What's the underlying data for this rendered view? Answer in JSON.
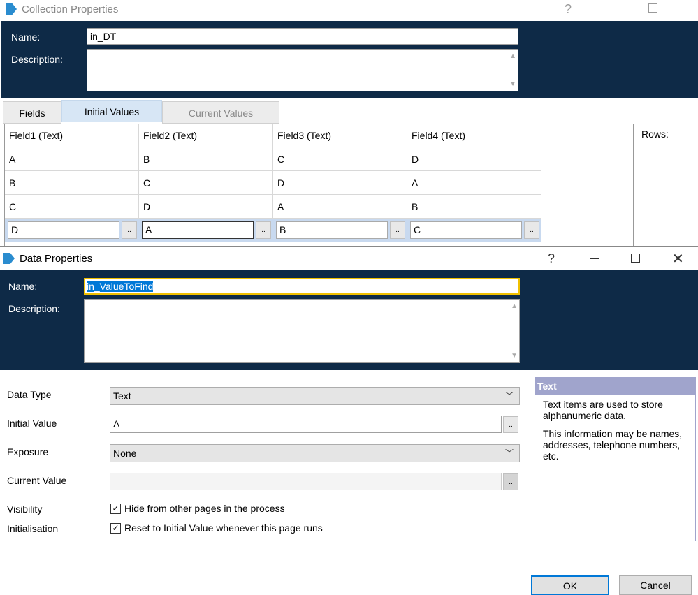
{
  "collection": {
    "title": "Collection Properties",
    "help": "?",
    "name_label": "Name:",
    "name_value": "in_DT",
    "description_label": "Description:",
    "tabs": [
      "Fields",
      "Initial Values",
      "Current Values"
    ],
    "rows_label": "Rows:",
    "columns": [
      "Field1  (Text)",
      "Field2  (Text)",
      "Field3  (Text)",
      "Field4  (Text)"
    ],
    "rows": [
      [
        "A",
        "B",
        "C",
        "D"
      ],
      [
        "B",
        "C",
        "D",
        "A"
      ],
      [
        "C",
        "D",
        "A",
        "B"
      ]
    ],
    "edit_row": [
      "D",
      "A",
      "B",
      "C"
    ],
    "ellipsis": ".."
  },
  "data": {
    "title": "Data Properties",
    "help": "?",
    "name_label": "Name:",
    "name_value": "in_ValueToFind",
    "description_label": "Description:",
    "data_type_label": "Data Type",
    "data_type_value": "Text",
    "initial_value_label": "Initial Value",
    "initial_value": "A",
    "exposure_label": "Exposure",
    "exposure_value": "None",
    "current_value_label": "Current Value",
    "current_value": "",
    "visibility_label": "Visibility",
    "visibility_text": "Hide from other pages in the process",
    "initialisation_label": "Initialisation",
    "initialisation_text": "Reset to Initial Value whenever this page runs",
    "info_title": "Text",
    "info_p1": "Text items are used to store alphanumeric data.",
    "info_p2": "This information may be names, addresses, telephone numbers, etc.",
    "ok": "OK",
    "cancel": "Cancel",
    "ellipsis": ".."
  }
}
